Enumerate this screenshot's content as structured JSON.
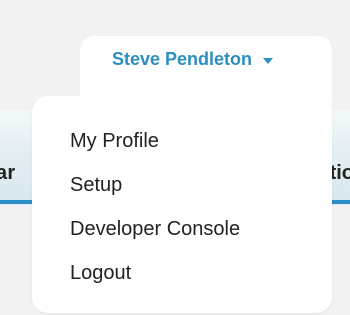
{
  "user_menu": {
    "name": "Steve Pendleton",
    "items": [
      {
        "label": "My Profile"
      },
      {
        "label": "Setup"
      },
      {
        "label": "Developer Console"
      },
      {
        "label": "Logout"
      }
    ]
  },
  "background_nav": {
    "left_fragment": "ar",
    "right_fragment": "tio"
  },
  "colors": {
    "accent": "#2d8ec0",
    "nav_underline": "#2b8fc7"
  }
}
